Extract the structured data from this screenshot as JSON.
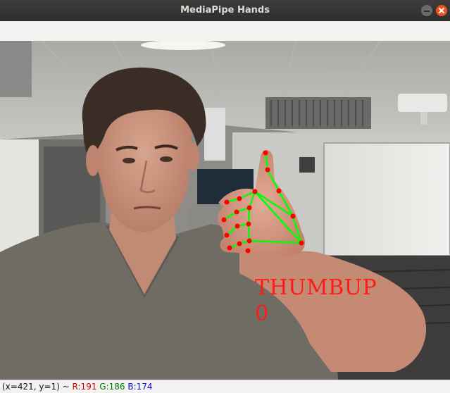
{
  "window": {
    "title": "MediaPipe Hands"
  },
  "overlay": {
    "gesture": "THUMBUP",
    "count": "0"
  },
  "status": {
    "coords": "(x=421, y=1) ~",
    "r": "R:191",
    "g": "G:186",
    "b": "B:174"
  },
  "colors": {
    "landmark": "#ff0000",
    "connection": "#00ff00",
    "overlay_text": "#ff1a1a",
    "titlebar": "#2e2e2e",
    "close_button": "#e95420"
  }
}
